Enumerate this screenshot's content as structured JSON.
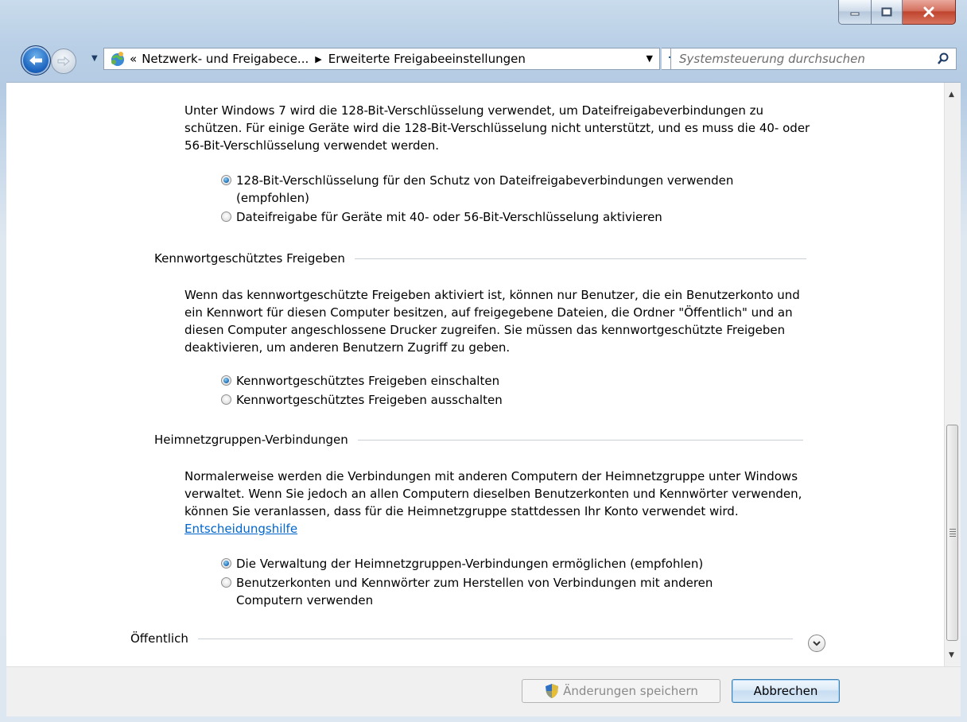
{
  "window": {
    "minimize_label": "",
    "maximize_label": "",
    "close_label": ""
  },
  "navbar": {
    "breadcrumb_prefix": "«",
    "breadcrumbs": [
      "Netzwerk- und Freigabece...",
      "Erweiterte Freigabeeinstellungen"
    ],
    "search_placeholder": "Systemsteuerung durchsuchen"
  },
  "encryption": {
    "description": "Unter Windows 7 wird die 128-Bit-Verschlüsselung verwendet, um Dateifreigabeverbindungen zu schützen. Für einige Geräte wird die 128-Bit-Verschlüsselung nicht unterstützt, und es muss die 40- oder 56-Bit-Verschlüsselung verwendet werden.",
    "options": [
      {
        "label": "128-Bit-Verschlüsselung für den Schutz von Dateifreigabeverbindungen verwenden (empfohlen)",
        "selected": true
      },
      {
        "label": "Dateifreigabe für Geräte mit 40- oder 56-Bit-Verschlüsselung aktivieren",
        "selected": false
      }
    ]
  },
  "password_sharing": {
    "heading": "Kennwortgeschütztes Freigeben",
    "description": "Wenn das kennwortgeschützte Freigeben aktiviert ist, können nur Benutzer, die ein Benutzerkonto und ein Kennwort für diesen Computer besitzen, auf freigegebene Dateien, die Ordner \"Öffentlich\" und an diesen Computer angeschlossene Drucker zugreifen. Sie müssen das kennwortgeschützte Freigeben deaktivieren, um anderen Benutzern Zugriff zu geben.",
    "options": [
      {
        "label": "Kennwortgeschütztes Freigeben einschalten",
        "selected": true
      },
      {
        "label": "Kennwortgeschütztes Freigeben ausschalten",
        "selected": false
      }
    ]
  },
  "homegroup": {
    "heading": "Heimnetzgruppen-Verbindungen",
    "description": "Normalerweise werden die Verbindungen mit anderen Computern der Heimnetzgruppe unter Windows verwaltet. Wenn Sie jedoch an allen Computern dieselben Benutzerkonten und Kennwörter verwenden, können Sie veranlassen, dass für die Heimnetzgruppe stattdessen Ihr Konto verwendet wird.",
    "help_link": "Entscheidungshilfe",
    "options": [
      {
        "label": "Die Verwaltung der Heimnetzgruppen-Verbindungen ermöglichen (empfohlen)",
        "selected": true
      },
      {
        "label": "Benutzerkonten und Kennwörter zum Herstellen von Verbindungen mit anderen Computern verwenden",
        "selected": false
      }
    ]
  },
  "public_profile": {
    "heading": "Öffentlich",
    "expanded": false
  },
  "footer": {
    "save_label": "Änderungen speichern",
    "cancel_label": "Abbrechen"
  },
  "colors": {
    "link": "#0066cc",
    "radio_selected": "#1a6bb5",
    "close_button": "#c0442e"
  },
  "icons": [
    "back-arrow-icon",
    "forward-arrow-icon",
    "network-location-icon",
    "refresh-icon",
    "search-icon",
    "chevron-down-icon",
    "uac-shield-icon"
  ]
}
